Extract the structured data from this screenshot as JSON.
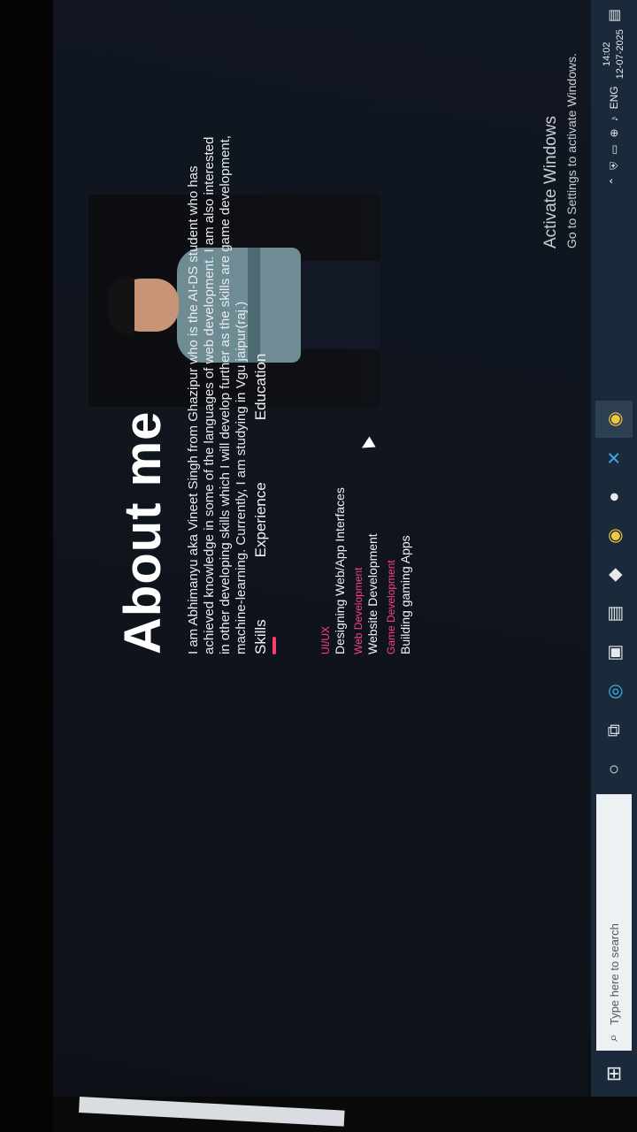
{
  "page": {
    "heading": "About me",
    "bio": "I am Abhimanyu aka Vineet Singh from Ghazipur who is the AI-DS student who has achieved knowledge in some of the languages of web development. I am also interested in other developing skills which I will develop further as the skills are game development, machine-learning. Currently, I am studying in Vgu jaipur(raj.)",
    "tabs": [
      {
        "label": "Skills"
      },
      {
        "label": "Experience"
      },
      {
        "label": "Education"
      }
    ],
    "skills": [
      {
        "category": "UI/UX",
        "detail": "Designing Web/App Interfaces"
      },
      {
        "category": "Web Development",
        "detail": "Website Development"
      },
      {
        "category": "Game Development",
        "detail": "Building gaming Apps"
      }
    ]
  },
  "taskbar": {
    "start_icon": "windows-icon",
    "search_placeholder": "Type here to search",
    "apps": [
      "cortana-icon",
      "task-view-icon",
      "edge-icon",
      "store-icon",
      "files-icon",
      "notes-icon",
      "chrome-icon",
      "app-icon",
      "vscode-icon",
      "chrome-icon"
    ],
    "tray": {
      "language": "ENG",
      "time": "14:02",
      "date": "12-07-2025"
    }
  },
  "watermark": {
    "title": "Activate Windows",
    "subtitle": "Go to Settings to activate Windows."
  },
  "colors": {
    "accent": "#ff3d8a",
    "taskbar": "#1a2a3a",
    "background": "#0f141c"
  }
}
